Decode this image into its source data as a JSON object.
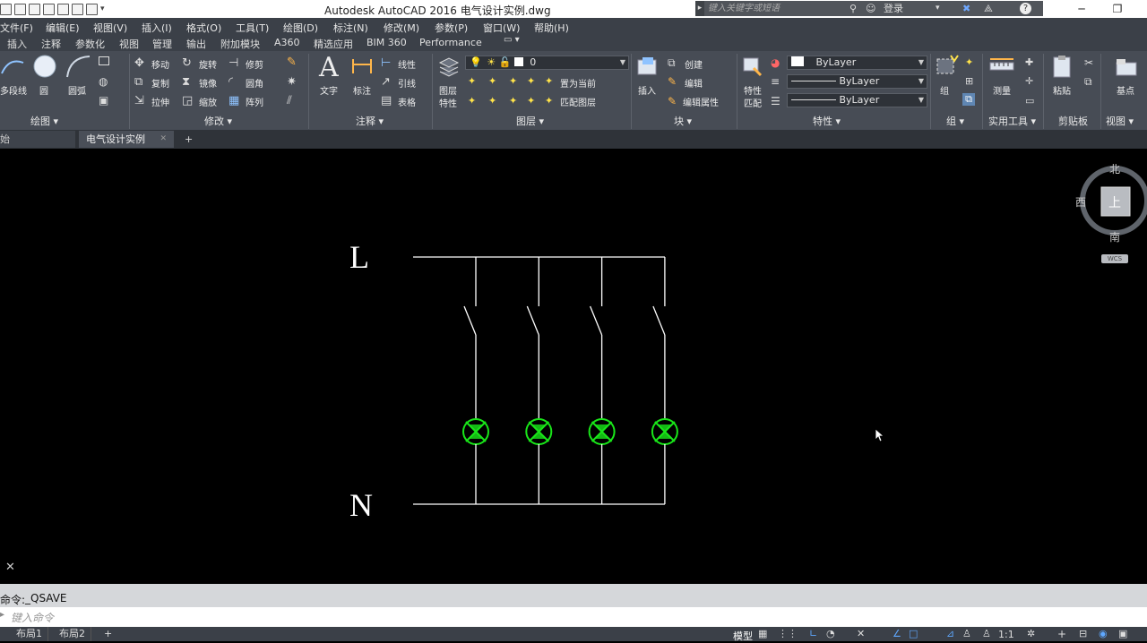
{
  "titlebar": {
    "title": "Autodesk AutoCAD 2016    电气设计实例.dwg",
    "search_placeholder": "键入关键字或短语",
    "login_label": "登录"
  },
  "menubar": {
    "items": [
      "文件(F)",
      "编辑(E)",
      "视图(V)",
      "插入(I)",
      "格式(O)",
      "工具(T)",
      "绘图(D)",
      "标注(N)",
      "修改(M)",
      "参数(P)",
      "窗口(W)",
      "帮助(H)"
    ]
  },
  "ribbon_tabs": {
    "items": [
      "插入",
      "注释",
      "参数化",
      "视图",
      "管理",
      "输出",
      "附加模块",
      "A360",
      "精选应用",
      "BIM 360",
      "Performance"
    ]
  },
  "ribbon": {
    "draw": {
      "polyline": "多段线",
      "circle": "圆",
      "arc": "圆弧",
      "footer": "绘图 ▾"
    },
    "modify": {
      "move": "移动",
      "rotate": "旋转",
      "trim": "修剪",
      "copy": "复制",
      "mirror": "镜像",
      "fillet": "圆角",
      "stretch": "拉伸",
      "scale": "缩放",
      "array": "阵列",
      "footer": "修改 ▾"
    },
    "annotation": {
      "text": "文字",
      "dimension": "标注",
      "linear": "线性",
      "leader": "引线",
      "table": "表格",
      "footer": "注释 ▾"
    },
    "layers": {
      "layer_props_1": "图层",
      "layer_props_2": "特性",
      "current_layer": "0",
      "set_current": "置为当前",
      "match_layer": "匹配图层",
      "footer": "图层 ▾"
    },
    "block": {
      "insert": "插入",
      "create": "创建",
      "edit": "编辑",
      "edit_attr": "编辑属性",
      "footer": "块 ▾"
    },
    "properties": {
      "match_1": "特性",
      "match_2": "匹配",
      "color": "ByLayer",
      "linetype": "ByLayer",
      "lineweight": "ByLayer",
      "footer": "特性 ▾"
    },
    "groups": {
      "group": "组",
      "footer": "组 ▾"
    },
    "utilities": {
      "measure": "测量",
      "footer": "实用工具 ▾"
    },
    "clipboard": {
      "paste": "粘贴",
      "footer": "剪贴板"
    },
    "view": {
      "base": "基点",
      "footer": "视图 ▾"
    }
  },
  "file_tabs": {
    "start_tab": "始",
    "active_tab": "电气设计实例",
    "close": "✕",
    "add": "+"
  },
  "drawing": {
    "label_L": "L",
    "label_N": "N",
    "lamp_count": 4,
    "colors": {
      "wire": "#ffffff",
      "lamp": "#19e619",
      "label": "#ffffff"
    }
  },
  "viewcube": {
    "north": "北",
    "south": "南",
    "west": "西",
    "top_face": "上",
    "wcs": "WCS"
  },
  "command": {
    "history_prefix": "命令:",
    "history_value": "_QSAVE",
    "input_placeholder": "键入命令",
    "close_glyph": "✕"
  },
  "layout_tabs": {
    "items": [
      "布局1",
      "布局2"
    ],
    "add": "+"
  },
  "statusbar": {
    "model": "模型",
    "scale": "1:1"
  }
}
